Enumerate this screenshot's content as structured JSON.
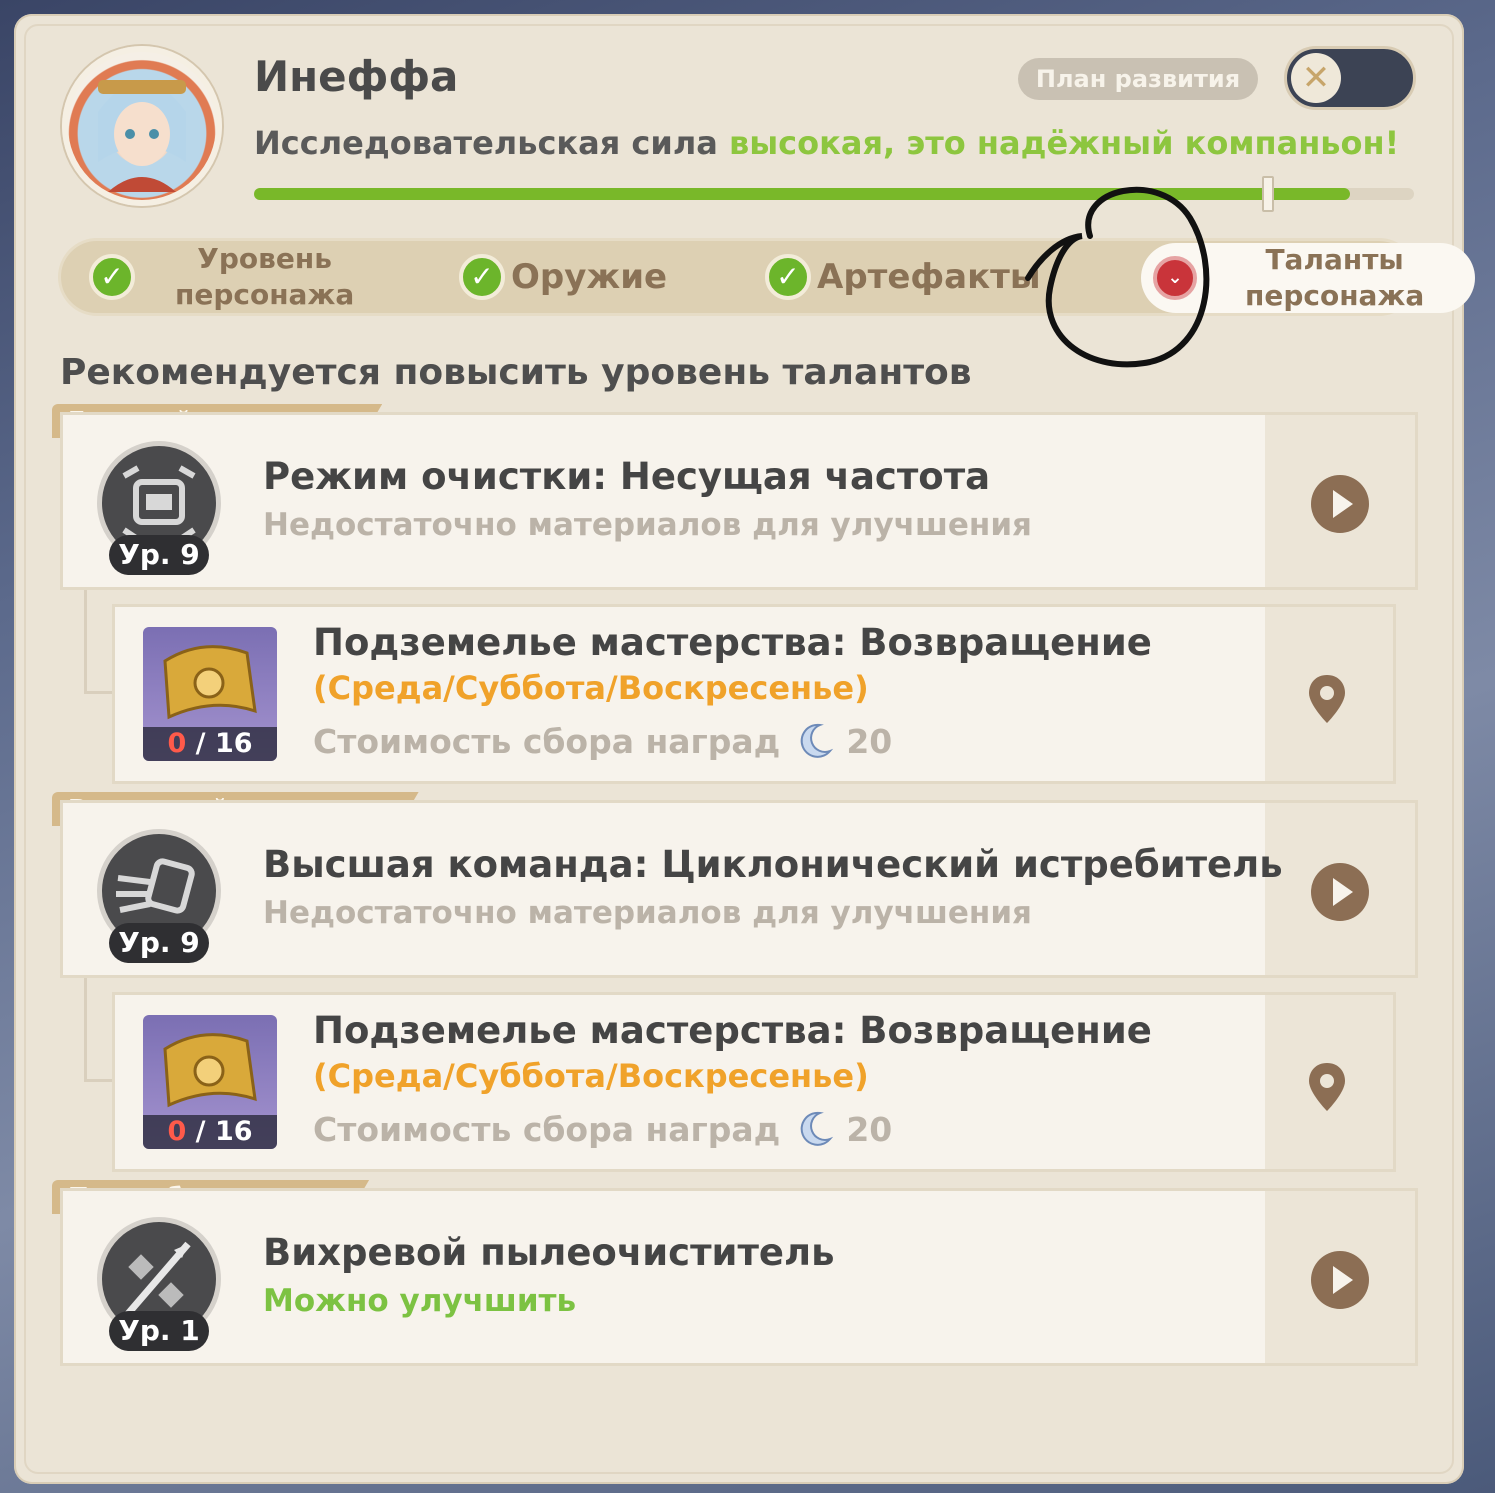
{
  "header": {
    "character_name": "Инеффа",
    "research_prefix": "Исследовательская сила ",
    "research_highlight": "высокая, это надёжный компаньон",
    "research_suffix": "!",
    "progress_fraction": 0.945,
    "plan_button_label": "План развития",
    "toggle_icon": "✕"
  },
  "tabs": [
    {
      "label": "Уровень\nперсонажа",
      "status": "complete",
      "icon": "✓"
    },
    {
      "label": "Оружие",
      "status": "complete",
      "icon": "✓"
    },
    {
      "label": "Артефакты",
      "status": "complete",
      "icon": "✓"
    },
    {
      "label": "Таланты\nперсонажа",
      "status": "warning",
      "active": true,
      "icon": "⌄"
    }
  ],
  "section_title": "Рекомендуется повысить уровень талантов",
  "priorities": [
    {
      "tag": "Главный приоритет",
      "talent": {
        "name": "Режим очистки: Несущая частота",
        "level": "Ур. 9",
        "status": "Недостаточно материалов для улучшения",
        "status_type": "insufficient",
        "icon": "purification-mode-icon"
      },
      "domain": {
        "name": "Подземелье мастерства: Возвращение",
        "days": "(Среда/Суббота/Воскресенье)",
        "cost_label": "Стоимость сбора наград",
        "cost_value": "20",
        "count_have": "0",
        "count_need": " / 16"
      }
    },
    {
      "tag": "Вторичный приоритет",
      "talent": {
        "name": "Высшая команда: Циклонический истребитель",
        "level": "Ур. 9",
        "status": "Недостаточно материалов для улучшения",
        "status_type": "insufficient",
        "icon": "cyclone-command-icon"
      },
      "domain": {
        "name": "Подземелье мастерства: Возвращение",
        "days": "(Среда/Суббота/Воскресенье)",
        "cost_label": "Стоимость сбора наград",
        "cost_value": "20",
        "count_have": "0",
        "count_need": " / 16"
      }
    },
    {
      "tag": "По необходимости",
      "talent": {
        "name": "Вихревой пылеочиститель",
        "level": "Ур. 1",
        "status": "Можно улучшить",
        "status_type": "upgradeable",
        "icon": "spear-attack-icon"
      }
    }
  ],
  "colors": {
    "accent_green": "#8dc63f",
    "progress_green": "#79b829",
    "warning_red": "#c9343a",
    "days_orange": "#f0a22a",
    "arrow_brown": "#8c6e54"
  }
}
